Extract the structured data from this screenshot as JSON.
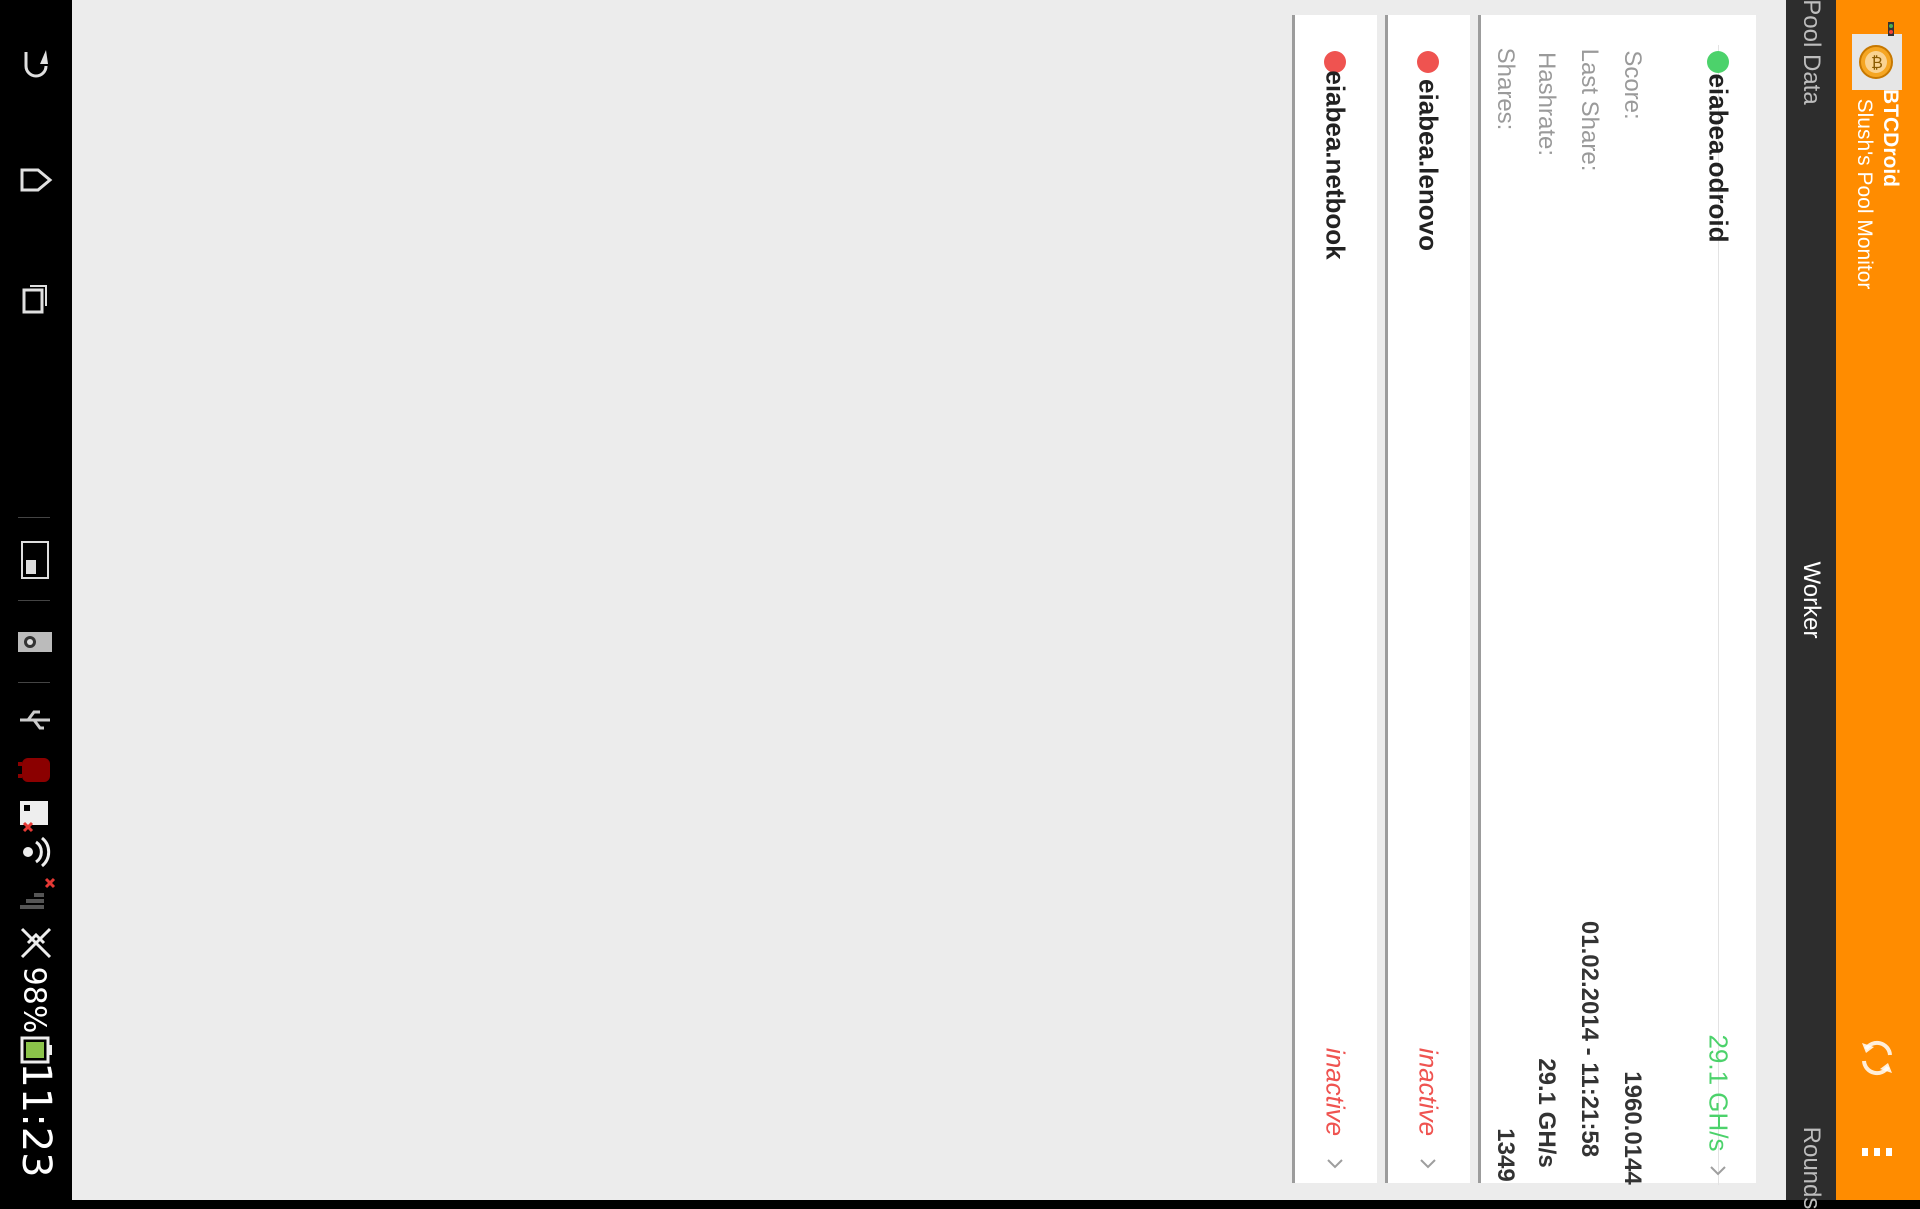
{
  "system": {
    "time": "11:23",
    "battery_percent": "98%",
    "icons": [
      "back-icon",
      "home-icon",
      "recent-apps-icon",
      "battery-widget-icon",
      "photo-icon",
      "usb-icon",
      "debug-android-icon",
      "sim-disabled-icon",
      "wifi-icon",
      "signal-icon",
      "no-data-icon",
      "battery-icon"
    ]
  },
  "app": {
    "title": "BTCDroid",
    "subtitle": "Slush's Pool Monitor",
    "accent_color": "#ff8c00"
  },
  "tabs": [
    {
      "label": "Pool Data",
      "active": false
    },
    {
      "label": "Worker",
      "active": true
    },
    {
      "label": "Rounds",
      "active": false
    }
  ],
  "workers": [
    {
      "name": "eiabea.odroid",
      "status_color": "#4cd26b",
      "hashrate_display": "29.1 GH/s",
      "expanded": true,
      "details": [
        {
          "label": "Score:",
          "value": "1960.0144"
        },
        {
          "label": "Last Share:",
          "value": "01.02.2014 - 11:21:58"
        },
        {
          "label": "Hashrate:",
          "value": "29.1 GH/s"
        },
        {
          "label": "Shares:",
          "value": "1349"
        }
      ]
    },
    {
      "name": "eiabea.lenovo",
      "status_color": "#ef5350",
      "hashrate_display": "inactive",
      "expanded": false
    },
    {
      "name": "eiabea.netbook",
      "status_color": "#ef5350",
      "hashrate_display": "inactive",
      "expanded": false
    }
  ]
}
